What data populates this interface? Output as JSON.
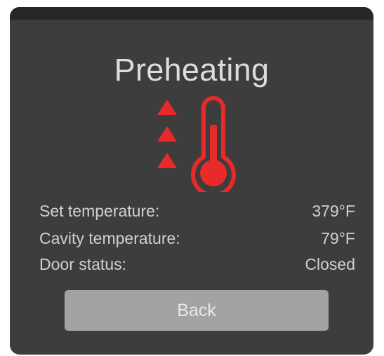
{
  "screen": {
    "title": "Preheating",
    "icon": "thermometer-rising-icon",
    "accent_color": "#e82a2a"
  },
  "status": {
    "set_temperature": {
      "label": "Set temperature:",
      "value": "379°F"
    },
    "cavity_temperature": {
      "label": "Cavity temperature:",
      "value": "79°F"
    },
    "door_status": {
      "label": "Door status:",
      "value": "Closed"
    }
  },
  "actions": {
    "back_label": "Back"
  }
}
